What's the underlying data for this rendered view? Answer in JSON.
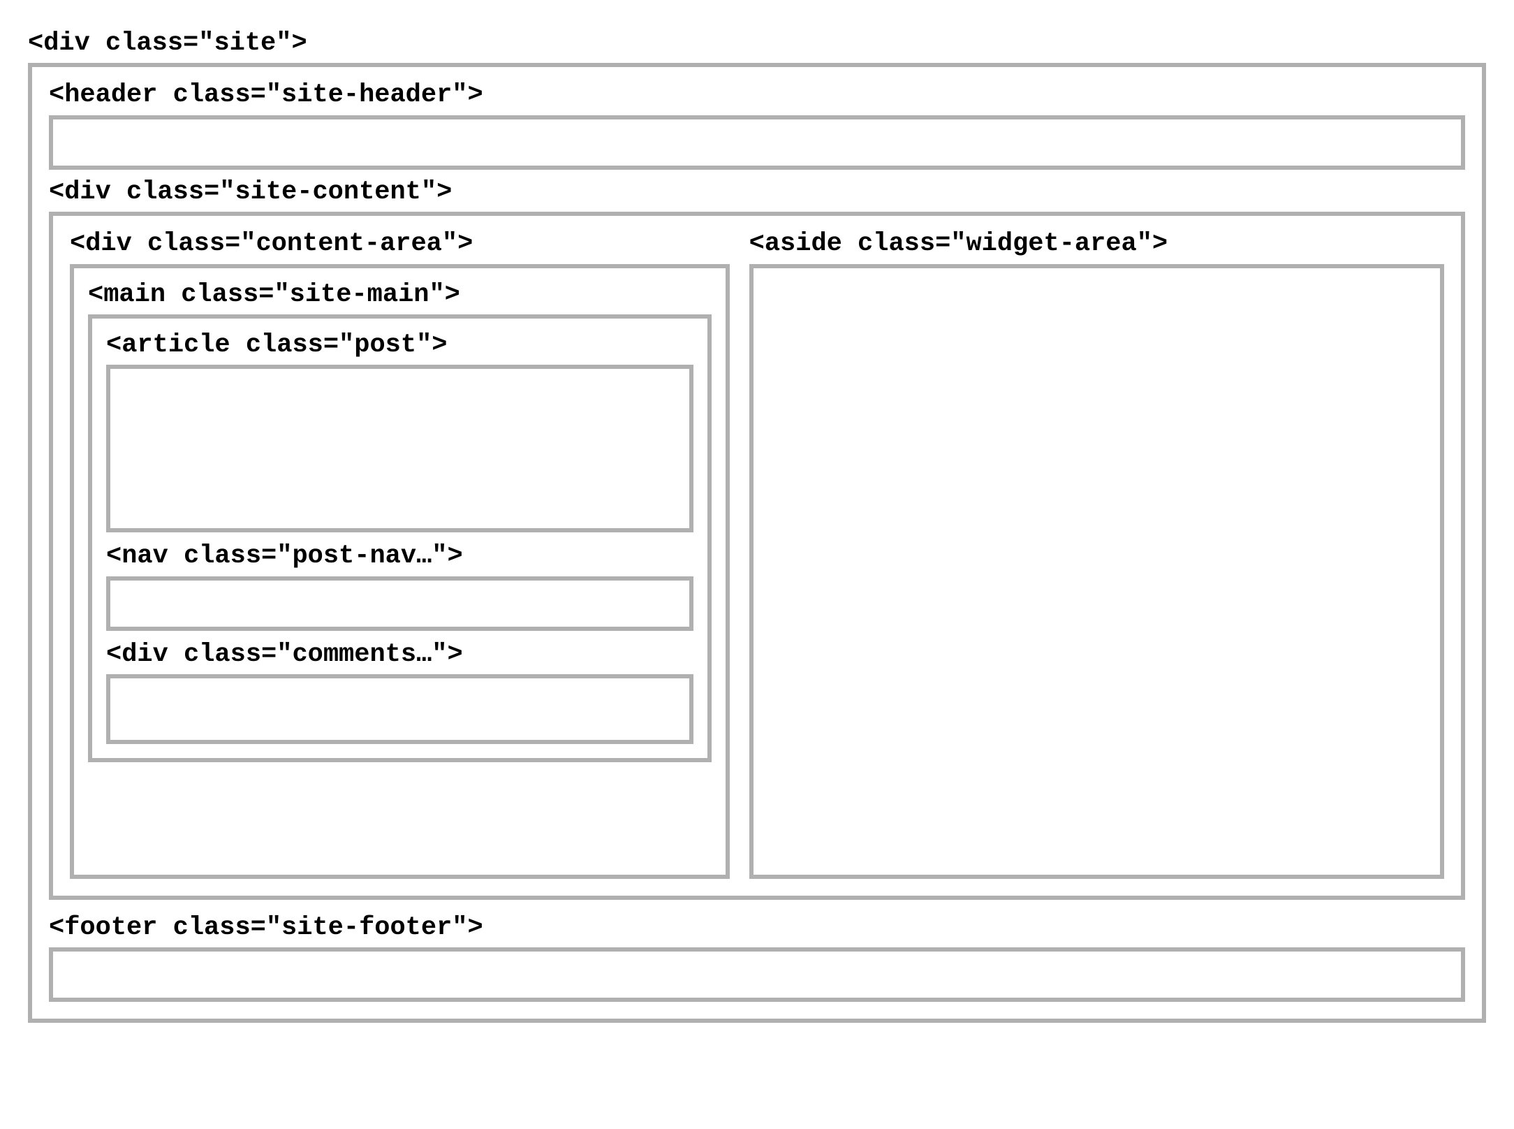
{
  "site": {
    "label": "<div class=\"site\">",
    "header": {
      "label": "<header class=\"site-header\">"
    },
    "content": {
      "label": "<div class=\"site-content\">",
      "content_area": {
        "label": "<div class=\"content-area\">",
        "site_main": {
          "label": "<main class=\"site-main\">",
          "post": {
            "label": "<article class=\"post\">"
          },
          "post_nav": {
            "label": "<nav class=\"post-nav…\">"
          },
          "comments": {
            "label": "<div class=\"comments…\">"
          }
        }
      },
      "widget_area": {
        "label": "<aside class=\"widget-area\">"
      }
    },
    "footer": {
      "label": "<footer class=\"site-footer\">"
    }
  }
}
